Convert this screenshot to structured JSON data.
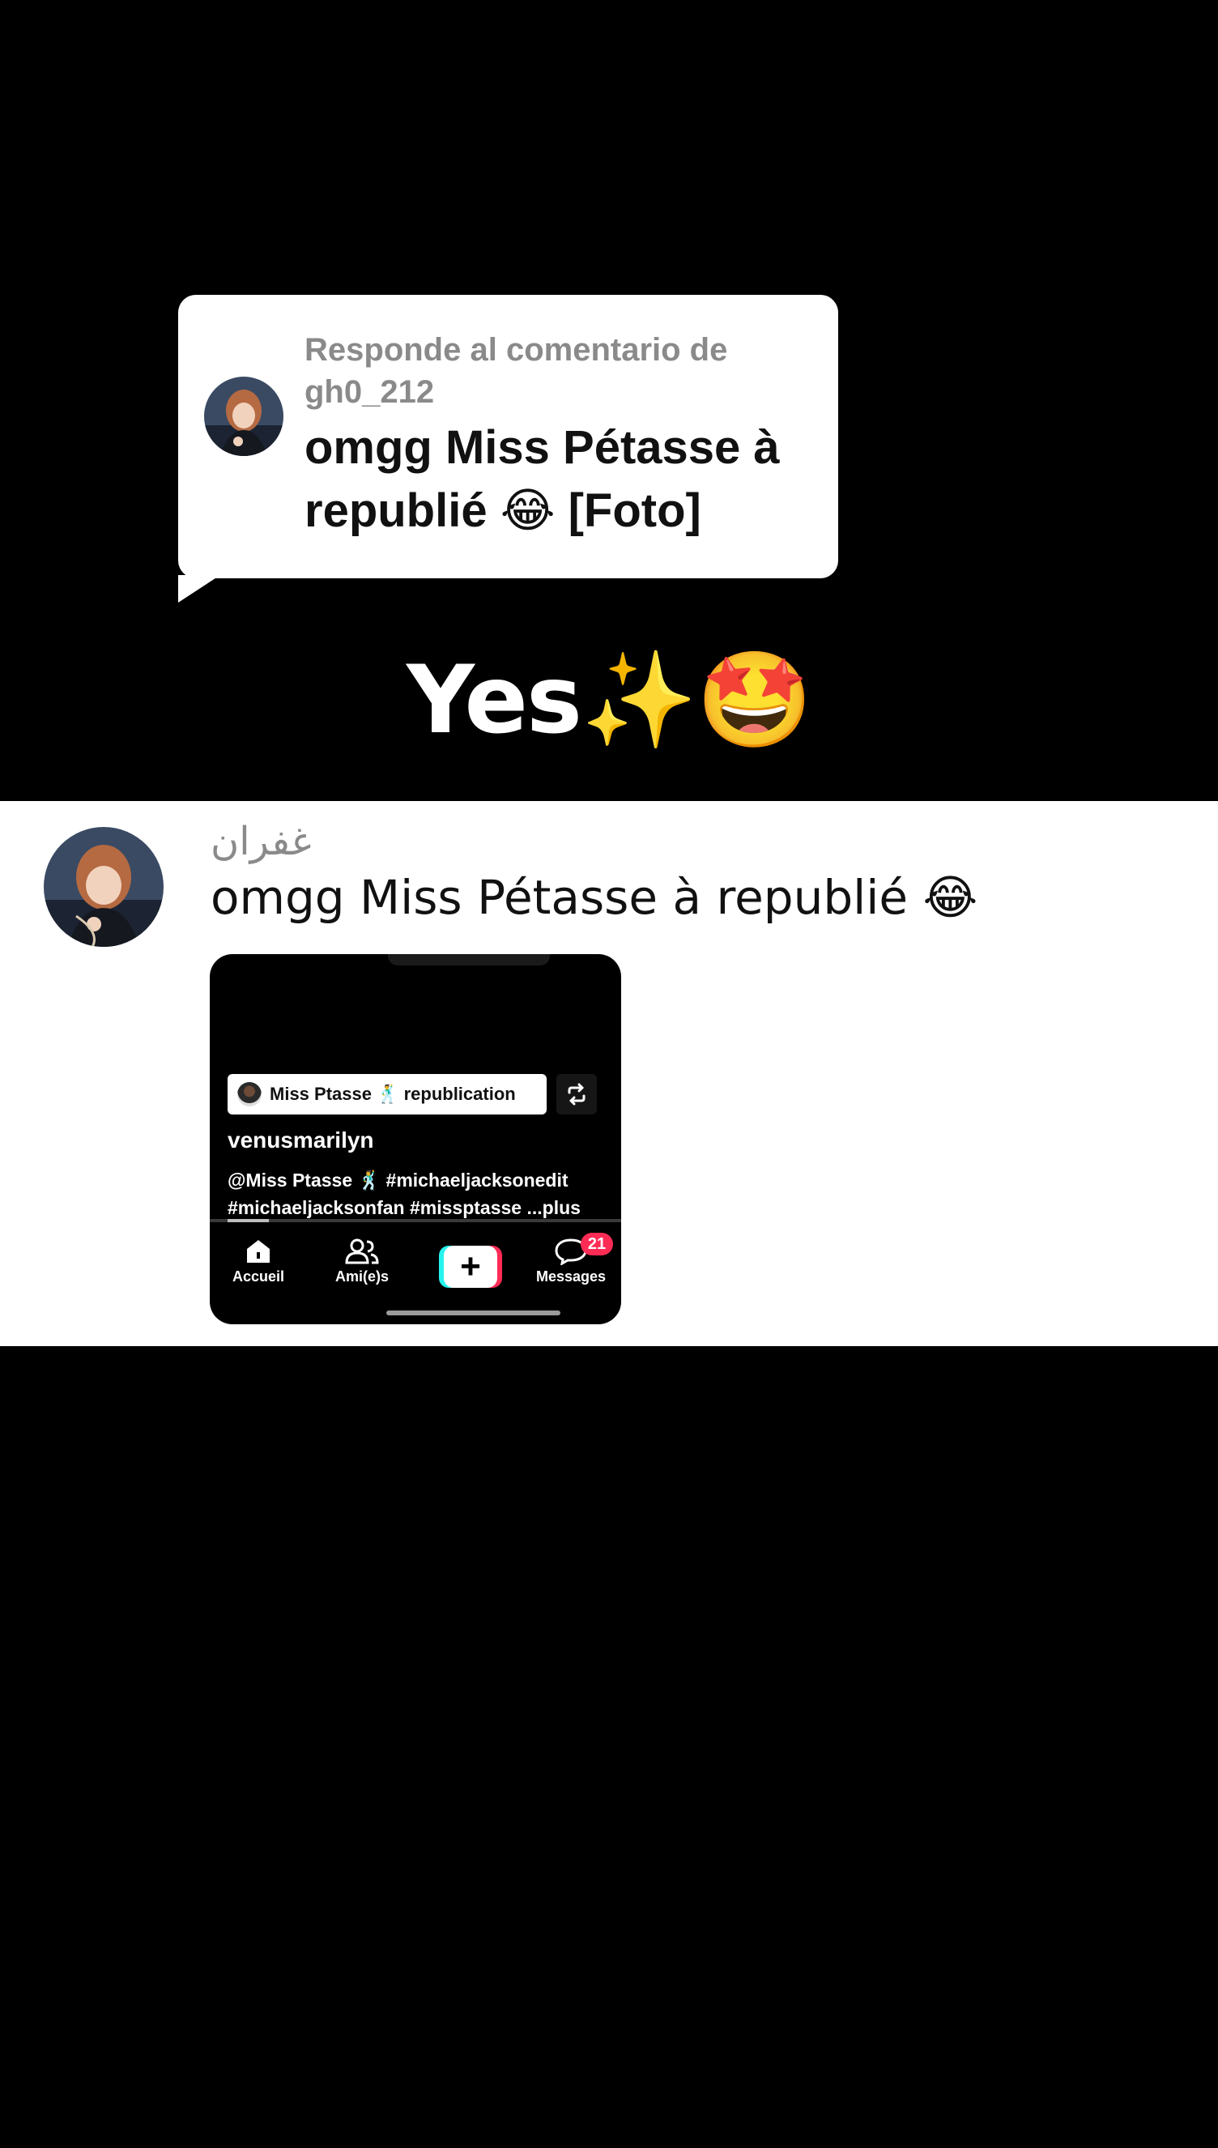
{
  "reply_bubble": {
    "header": "Responde al comentario de gh0_212",
    "comment": "omgg Miss Pétasse à republié 😂 [Foto]"
  },
  "caption": "Yes✨🤩",
  "comment": {
    "username": "غفران",
    "text": "omgg Miss Pétasse à republié 😂"
  },
  "attachment": {
    "repost_label": "Miss Ptasse 🕺 republication",
    "username": "venusmarilyn",
    "description": "@Miss Ptasse 🕺 #michaeljacksonedit\n#michaeljacksonfan #missptasse ...plus",
    "progress_fraction": 0.1,
    "nav": {
      "home_label": "Accueil",
      "friends_label": "Ami(e)s",
      "create_label": "+",
      "messages_label": "Messages",
      "messages_badge": "21"
    }
  },
  "colors": {
    "background": "#000000",
    "bubble": "#ffffff",
    "badge": "#fe2c55",
    "cyan": "#25f4ee"
  }
}
